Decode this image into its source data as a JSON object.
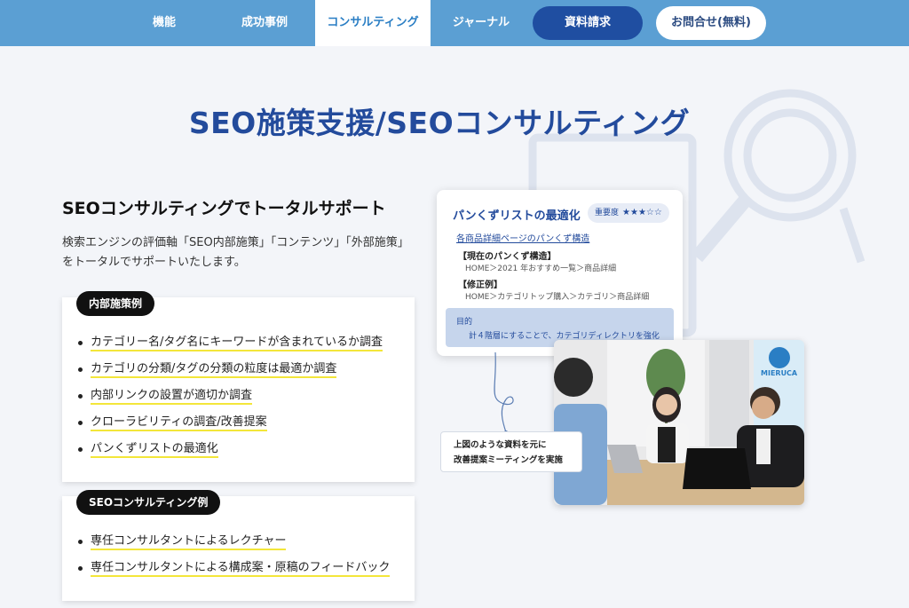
{
  "nav": {
    "items": [
      "機能",
      "成功事例",
      "コンサルティング",
      "ジャーナル"
    ],
    "active_index": 2,
    "request_docs": "資料請求",
    "contact": "お問合せ(無料)"
  },
  "page_title": "SEO施策支援/SEOコンサルティング",
  "section": {
    "heading": "SEOコンサルティングでトータルサポート",
    "lead": "検索エンジンの評価軸「SEO内部施策」「コンテンツ」「外部施策」 をトータルでサポートいたします。"
  },
  "internal_card": {
    "label": "内部施策例",
    "items": [
      "カテゴリー名/タグ名にキーワードが含まれているか調査",
      "カテゴリの分類/タグの分類の粒度は最適か調査",
      "内部リンクの設置が適切か調査",
      "クローラビリティの調査/改善提案",
      "パンくずリストの最適化"
    ]
  },
  "consulting_card": {
    "label": "SEOコンサルティング例",
    "items": [
      "専任コンサルタントによるレクチャー",
      "専任コンサルタントによる構成案・原稿のフィードバック"
    ]
  },
  "doc_card": {
    "title": "パンくずリストの最適化",
    "badge_label": "重要度",
    "badge_stars": "★★★☆☆",
    "link": "各商品詳細ページのパンくず構造",
    "current_heading": "【現在のパンくず構造】",
    "current_text": "HOME＞2021 年おすすめ一覧＞商品詳細",
    "fix_heading": "【修正例】",
    "fix_text": "HOME＞カテゴリトップ購入＞カテゴリ＞商品詳細",
    "goal_label": "目的",
    "goal_text": "計４階層にすることで、カテゴリディレクトリを強化"
  },
  "caption": {
    "line1": "上図のような資料を元に",
    "line2": "改善提案ミーティングを実施"
  },
  "photo": {
    "banner_text": "MIERUCA"
  },
  "colors": {
    "nav_bg": "#5b9fd3",
    "title_blue": "#234b9c",
    "button_blue": "#1f4ea1",
    "highlight_yellow": "#f3e63a"
  }
}
